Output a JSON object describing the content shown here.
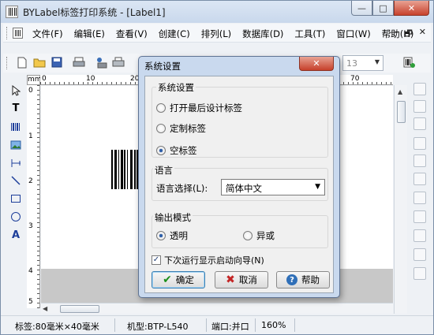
{
  "window": {
    "title": "BYLabel标签打印系统 - [Label1]",
    "caption_min": "—",
    "caption_max": "□",
    "caption_close": "✕"
  },
  "menu": {
    "items": [
      {
        "label": "文件(F)"
      },
      {
        "label": "编辑(E)"
      },
      {
        "label": "查看(V)"
      },
      {
        "label": "创建(C)"
      },
      {
        "label": "排列(L)"
      },
      {
        "label": "数据库(D)"
      },
      {
        "label": "工具(T)"
      },
      {
        "label": "窗口(W)"
      },
      {
        "label": "帮助(H)"
      }
    ],
    "mdi_min": "—",
    "mdi_restore": "🗗",
    "mdi_close": "✕"
  },
  "toolbar": {
    "font_size": "13"
  },
  "ruler": {
    "unit": "mm",
    "top_labels": [
      "0",
      "10",
      "20",
      "70",
      "80"
    ],
    "left_labels": [
      "0",
      "1",
      "2",
      "3",
      "4",
      "5"
    ]
  },
  "dialog": {
    "title": "系统设置",
    "close": "✕",
    "group_startup": "系统设置",
    "options": [
      {
        "label": "打开最后设计标签",
        "checked": false
      },
      {
        "label": "定制标签",
        "checked": false
      },
      {
        "label": "空标签",
        "checked": true
      }
    ],
    "group_language": "语言",
    "language_label": "语言选择(L):",
    "language_value": "简体中文",
    "group_output": "输出模式",
    "output_options": [
      {
        "label": "透明",
        "checked": true
      },
      {
        "label": "异或",
        "checked": false
      }
    ],
    "startup_wizard_label": "下次运行显示启动向导(N)",
    "startup_wizard_checked": true,
    "ok": "确定",
    "cancel": "取消",
    "help": "帮助"
  },
  "status": {
    "label_size": "标签:80毫米×40毫米",
    "model": "机型:BTP-L540",
    "port": "端口:并口",
    "zoom": "160%"
  }
}
